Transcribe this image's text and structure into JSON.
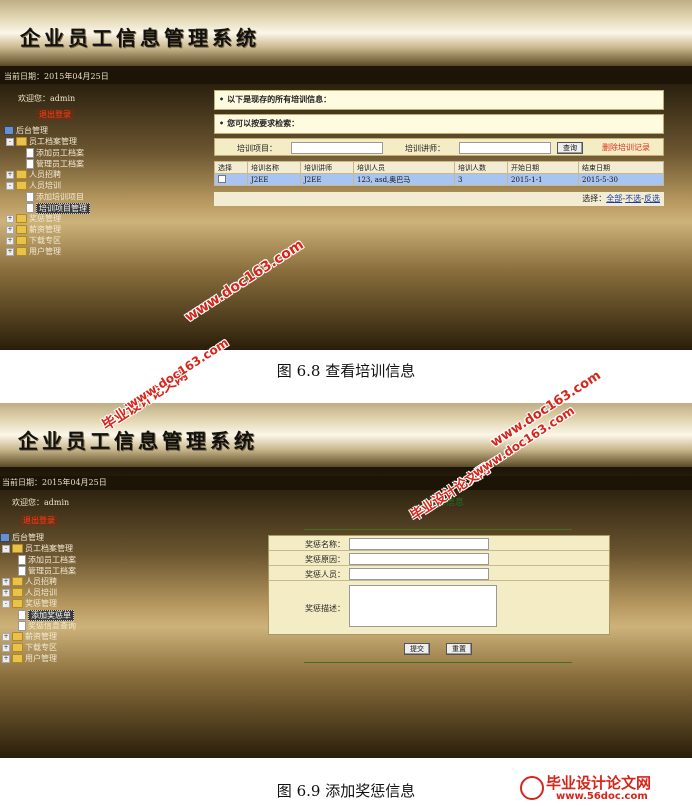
{
  "screenshot1": {
    "app_title": "企业员工信息管理系统",
    "date_text": "当前日期：2015年04月25日",
    "welcome": "欢迎您：admin",
    "logout": "退出登录",
    "tree": {
      "root": "后台管理",
      "n1": "员工档案管理",
      "n1a": "添加员工档案",
      "n1b": "管理员工档案",
      "n2": "人员招聘",
      "n3": "人员培训",
      "n3a": "添加培训项目",
      "n3b": "培训项目管理",
      "n4": "奖惩管理",
      "n5": "薪资管理",
      "n6": "下载专区",
      "n7": "用户管理"
    },
    "info_title": "以下是现存的所有培训信息：",
    "search_title": "您可以按要求检索：",
    "search_item_label": "培训项目：",
    "search_teacher_label": "培训讲师：",
    "query_button": "查询",
    "delete_link": "删除培训记录",
    "table_headers": [
      "选择",
      "培训名称",
      "培训讲师",
      "培训人员",
      "培训人数",
      "开始日期",
      "结束日期"
    ],
    "table_row": [
      "",
      "J2EE",
      "J2EE",
      "123, asd,奥巴马",
      "3",
      "2015-1-1",
      "2015-5-30"
    ],
    "select_label": "选择：",
    "select_all": "全部",
    "select_none": "不选",
    "select_invert": "反选",
    "select_sep": "-",
    "caption": "图 6.8  查看培训信息"
  },
  "screenshot2": {
    "app_title": "企业员工信息管理系统",
    "date_text": "当前日期：2015年04月25日",
    "welcome": "欢迎您：admin",
    "logout": "退出登录",
    "tree": {
      "root": "后台管理",
      "n1": "员工档案管理",
      "n1a": "添加员工档案",
      "n1b": "管理员工档案",
      "n2": "人员招聘",
      "n3": "人员培训",
      "n4": "奖惩管理",
      "n4a": "添加奖惩单",
      "n4b": "奖惩信息查询",
      "n5": "薪资管理",
      "n6": "下载专区",
      "n7": "用户管理"
    },
    "section_title": "奖惩信息",
    "form_name_label": "奖惩名称：",
    "form_reason_label": "奖惩原因：",
    "form_person_label": "奖惩人员：",
    "form_desc_label": "奖惩描述：",
    "submit_button": "提交",
    "reset_button": "重置",
    "caption": "图 6.9  添加奖惩信息"
  },
  "watermarks": {
    "site1": "www.doc163.com",
    "brand1": "毕业设计论文网",
    "site1b": "www.doc163.com",
    "brand2": "毕业设计论文网",
    "site2": "www.doc163.com",
    "brand2b": "毕业设计论文网",
    "footer_brand": "毕业设计论文网",
    "footer_site": "www.56doc.com"
  },
  "colors": {
    "accent_red": "#e03020",
    "link_blue": "#1a3aa8",
    "row_highlight": "#a8c4f0"
  }
}
